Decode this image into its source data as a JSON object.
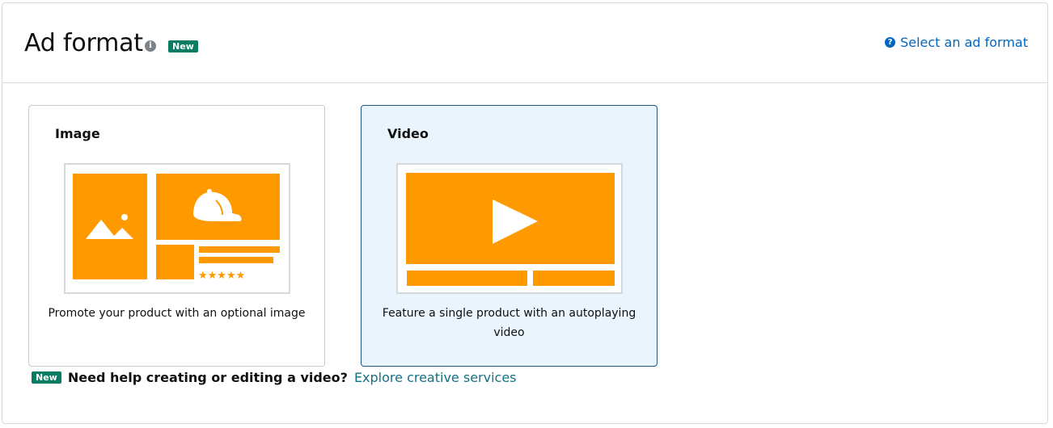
{
  "header": {
    "title": "Ad format",
    "info_icon": "info-icon",
    "badge": "New",
    "help_link": "Select an ad format",
    "help_icon": "question-circle-icon"
  },
  "cards": [
    {
      "title": "Image",
      "description": "Promote your product with an optional image",
      "selected": false,
      "illustration": "image-ad-illustration"
    },
    {
      "title": "Video",
      "description": "Feature a single product with an autoplaying video",
      "selected": true,
      "illustration": "video-ad-illustration"
    }
  ],
  "help": {
    "badge": "New",
    "question": "Need help creating or editing a video?",
    "link": "Explore creative services"
  },
  "colors": {
    "accent": "#ff9900",
    "link": "#0066c0",
    "badge": "#067d62",
    "selected_bg": "#eaf4fc",
    "selected_border": "#1d5a8a"
  }
}
